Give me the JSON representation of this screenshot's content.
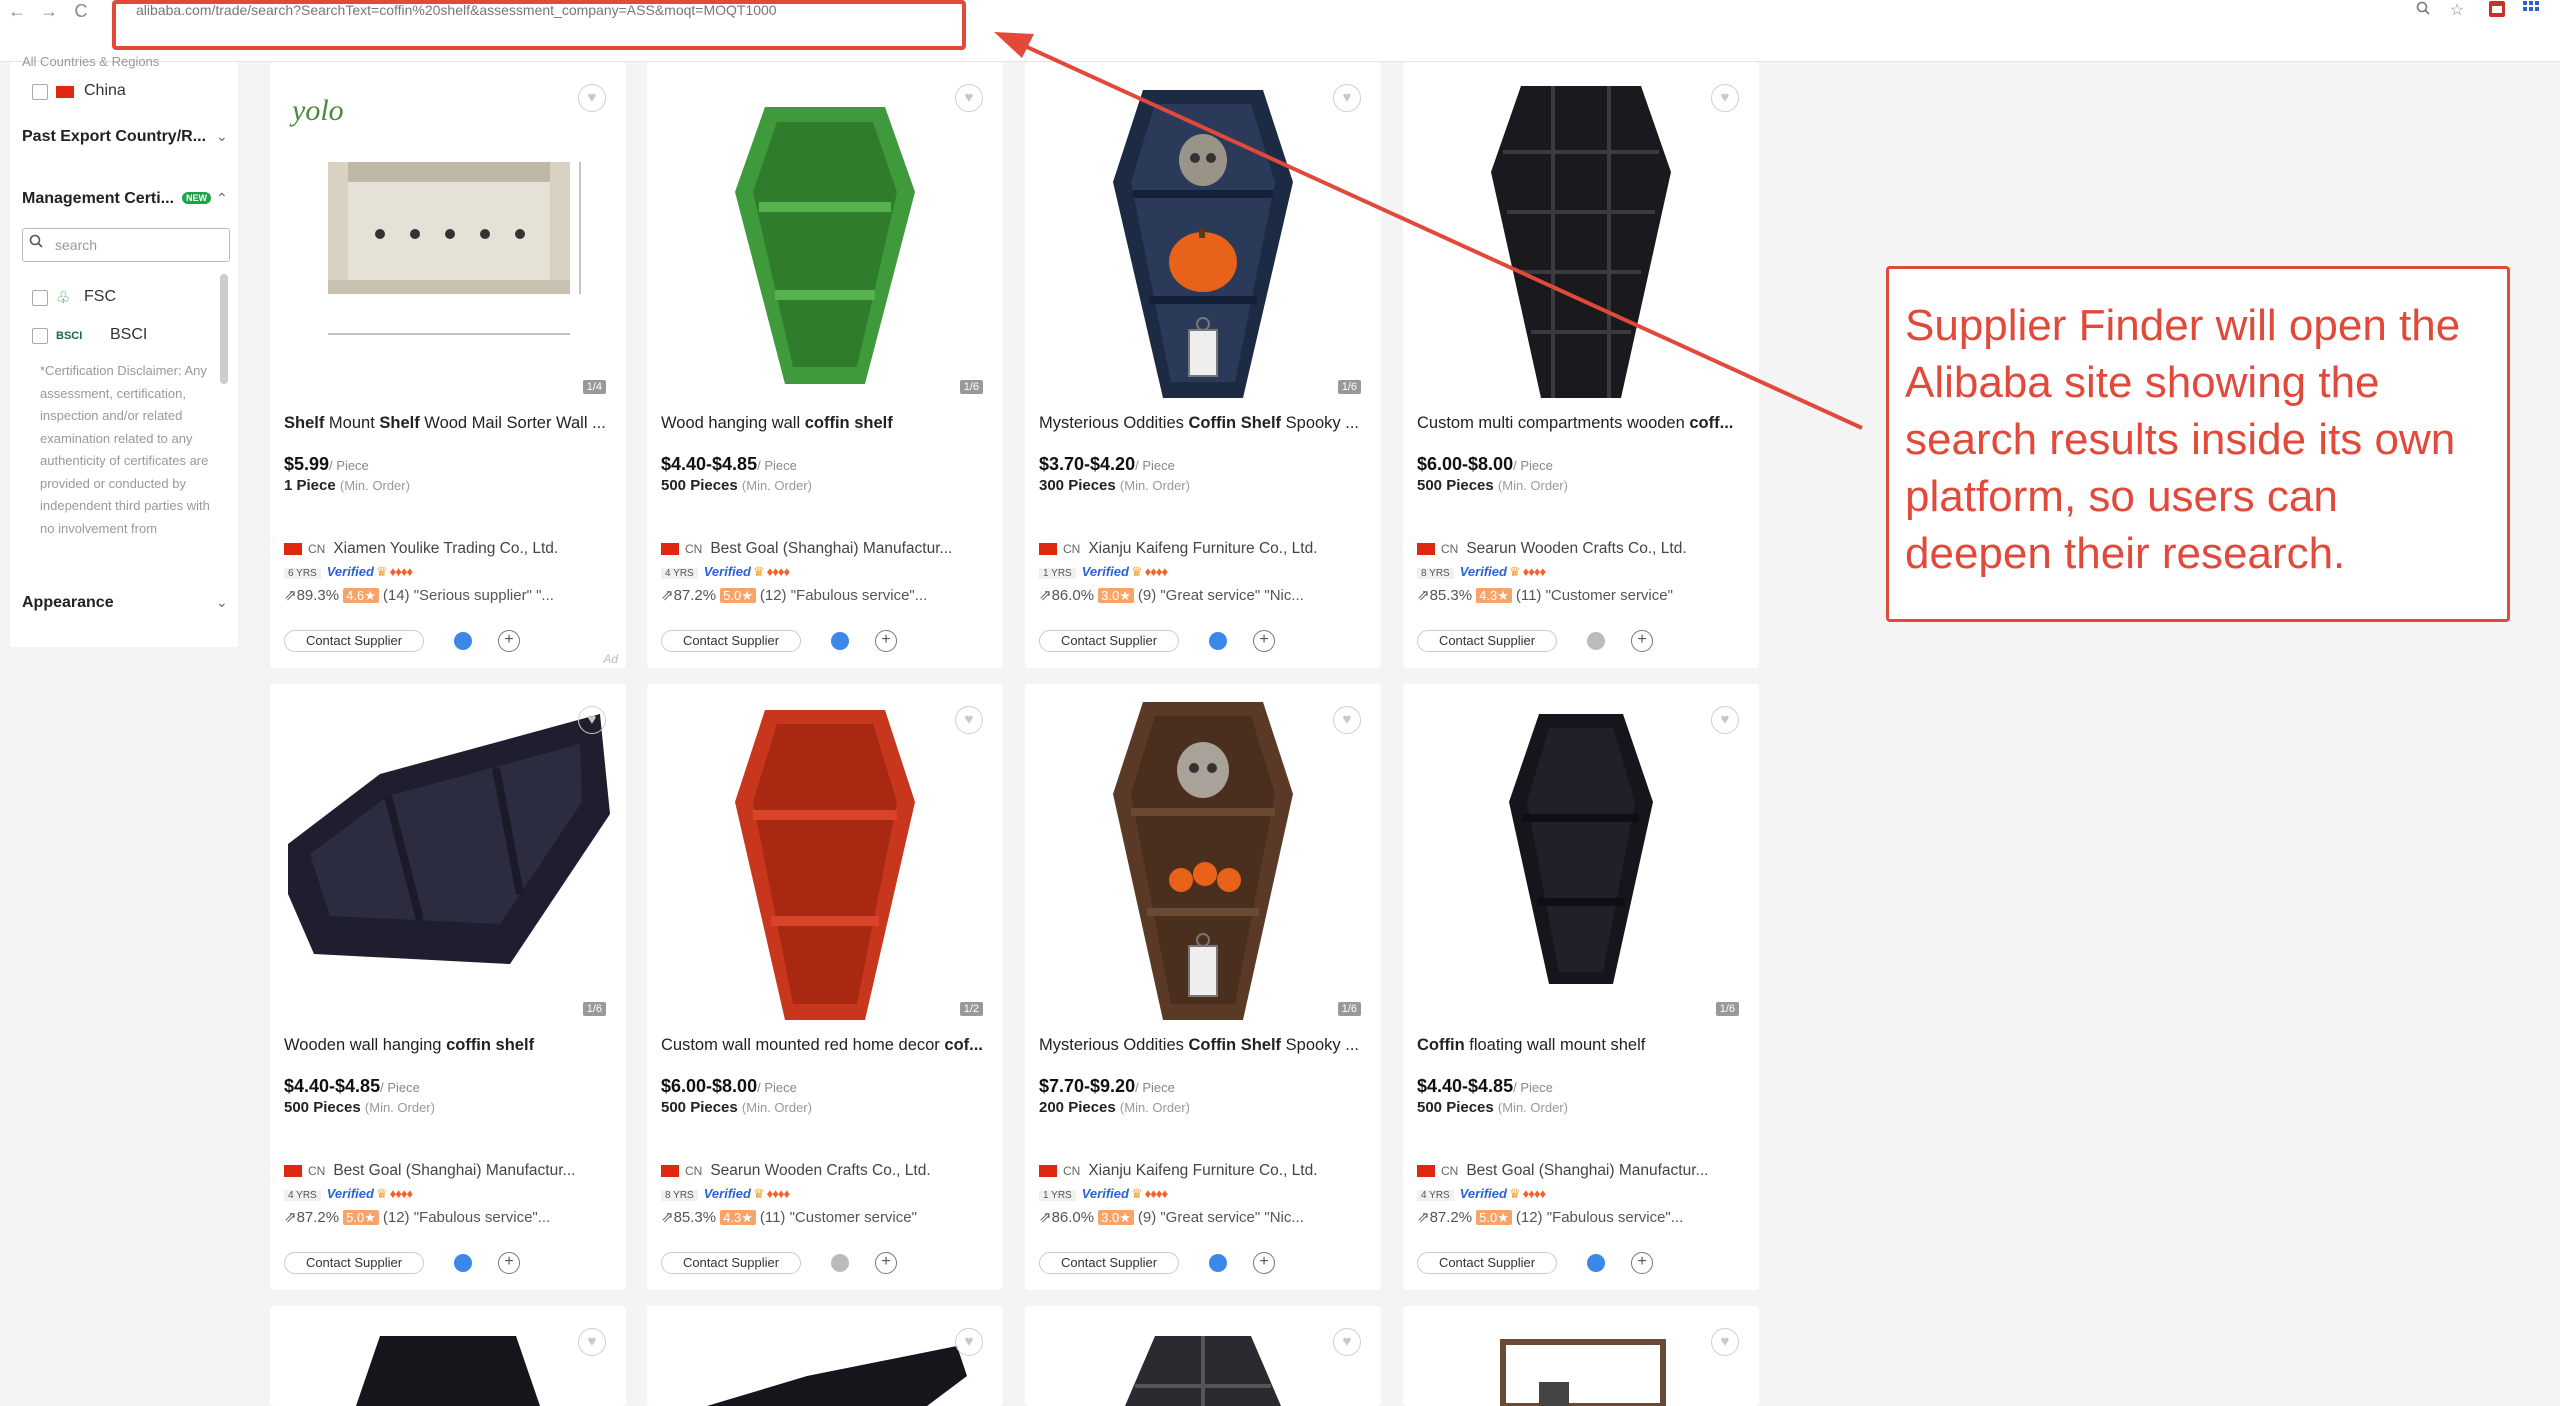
{
  "browser": {
    "url": "alibaba.com/trade/search?SearchText=coffin%20shelf&assessment_company=ASS&moqt=MOQT1000",
    "back": "←",
    "forward": "→",
    "reload": "C",
    "zoom_icon": "zoom-icon",
    "star_icon": "star-icon"
  },
  "sidebar": {
    "cut_header": "All Countries & Regions",
    "country": "China",
    "past_export": "Past Export Country/R...",
    "management": "Management Certi...",
    "new_badge": "NEW",
    "search_placeholder": "search",
    "cert_fsc": "FSC",
    "cert_bsci_logo": "BSCI",
    "cert_bsci": "BSCI",
    "disclaimer": "*Certification Disclaimer: Any assessment, certification, inspection and/or related examination related to any authenticity of certificates are provided or conducted by independent third parties with no involvement from",
    "appearance": "Appearance"
  },
  "products": [
    {
      "title_pre": "Shelf",
      "title_mid": " Mount ",
      "title_bold": "Shelf",
      "title_post": " Wood Mail Sorter Wall ...",
      "price": "$5.99",
      "moq": "1 Piece",
      "supplier": "Xiamen Youlike Trading Co., Ltd.",
      "yrs": "6 YRS",
      "rate": "89.3%",
      "score": "4.6★",
      "reviews": "(14) \"Serious supplier\" \"...",
      "count": "1/4",
      "chat": "blue",
      "ad": "Ad"
    },
    {
      "title_pre": "",
      "title_mid": "Wood hanging wall ",
      "title_bold": "coffin shelf",
      "title_post": "",
      "price": "$4.40-$4.85",
      "moq": "500 Pieces",
      "supplier": "Best Goal (Shanghai) Manufactur...",
      "yrs": "4 YRS",
      "rate": "87.2%",
      "score": "5.0★",
      "reviews": "(12) \"Fabulous service\"...",
      "count": "1/6",
      "chat": "blue",
      "ad": ""
    },
    {
      "title_pre": "",
      "title_mid": "Mysterious Oddities ",
      "title_bold": "Coffin Shelf",
      "title_post": " Spooky ...",
      "price": "$3.70-$4.20",
      "moq": "300 Pieces",
      "supplier": "Xianju Kaifeng Furniture Co., Ltd.",
      "yrs": "1 YRS",
      "rate": "86.0%",
      "score": "3.0★",
      "reviews": "(9) \"Great service\" \"Nic...",
      "count": "1/6",
      "chat": "blue",
      "ad": ""
    },
    {
      "title_pre": "",
      "title_mid": "Custom multi compartments wooden ",
      "title_bold": "coff...",
      "title_post": "",
      "price": "$6.00-$8.00",
      "moq": "500 Pieces",
      "supplier": "Searun Wooden Crafts Co., Ltd.",
      "yrs": "8 YRS",
      "rate": "85.3%",
      "score": "4.3★",
      "reviews": "(11) \"Customer service\"",
      "count": "",
      "chat": "grey",
      "ad": ""
    },
    {
      "title_pre": "",
      "title_mid": "Wooden wall hanging ",
      "title_bold": "coffin shelf",
      "title_post": "",
      "price": "$4.40-$4.85",
      "moq": "500 Pieces",
      "supplier": "Best Goal (Shanghai) Manufactur...",
      "yrs": "4 YRS",
      "rate": "87.2%",
      "score": "5.0★",
      "reviews": "(12) \"Fabulous service\"...",
      "count": "1/6",
      "chat": "blue",
      "ad": ""
    },
    {
      "title_pre": "",
      "title_mid": "Custom wall mounted red home decor ",
      "title_bold": "cof...",
      "title_post": "",
      "price": "$6.00-$8.00",
      "moq": "500 Pieces",
      "supplier": "Searun Wooden Crafts Co., Ltd.",
      "yrs": "8 YRS",
      "rate": "85.3%",
      "score": "4.3★",
      "reviews": "(11) \"Customer service\"",
      "count": "1/2",
      "chat": "grey",
      "ad": ""
    },
    {
      "title_pre": "",
      "title_mid": "Mysterious Oddities ",
      "title_bold": "Coffin Shelf",
      "title_post": " Spooky ...",
      "price": "$7.70-$9.20",
      "moq": "200 Pieces",
      "supplier": "Xianju Kaifeng Furniture Co., Ltd.",
      "yrs": "1 YRS",
      "rate": "86.0%",
      "score": "3.0★",
      "reviews": "(9) \"Great service\" \"Nic...",
      "count": "1/6",
      "chat": "blue",
      "ad": ""
    },
    {
      "title_pre": "",
      "title_mid": "",
      "title_bold": "Coffin",
      "title_post": " floating wall mount shelf",
      "price": "$4.40-$4.85",
      "moq": "500 Pieces",
      "supplier": "Best Goal (Shanghai) Manufactur...",
      "yrs": "4 YRS",
      "rate": "87.2%",
      "score": "5.0★",
      "reviews": "(12) \"Fabulous service\"...",
      "count": "1/6",
      "chat": "blue",
      "ad": ""
    }
  ],
  "card_labels": {
    "unit": "/ Piece",
    "min_order": "(Min. Order)",
    "country_code": "CN",
    "verified": "Verified",
    "contact": "Contact Supplier"
  },
  "annotation": {
    "text": "Supplier Finder will open the Alibaba site showing the search results inside its own platform, so users can deepen their research.",
    "color": "#e14a3b"
  }
}
